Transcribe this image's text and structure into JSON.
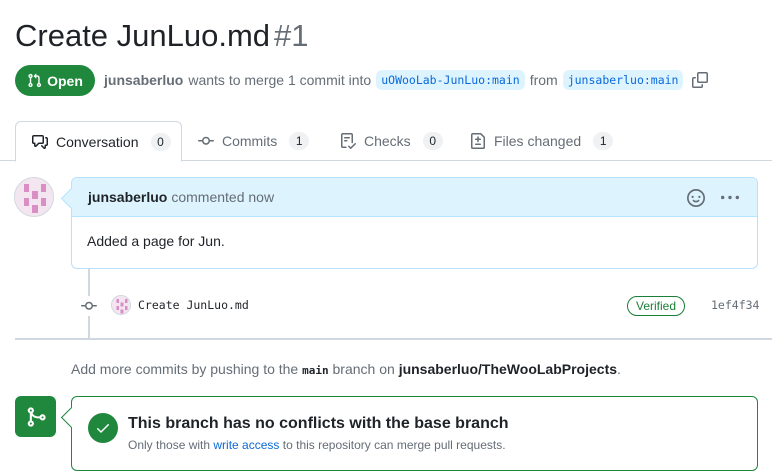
{
  "pr": {
    "title": "Create JunLuo.md",
    "number": "#1",
    "state": "Open",
    "author": "junsaberluo",
    "merge_text": "wants to merge 1 commit into",
    "base_branch": "uOWooLab-JunLuo:main",
    "from_text": "from",
    "head_branch": "junsaberluo:main"
  },
  "tabs": [
    {
      "label": "Conversation",
      "count": "0",
      "icon": "comment-discussion-icon"
    },
    {
      "label": "Commits",
      "count": "1",
      "icon": "git-commit-icon"
    },
    {
      "label": "Checks",
      "count": "0",
      "icon": "checklist-icon"
    },
    {
      "label": "Files changed",
      "count": "1",
      "icon": "file-diff-icon"
    }
  ],
  "comment": {
    "author": "junsaberluo",
    "action": "commented now",
    "body": "Added a page for Jun."
  },
  "commit": {
    "message": "Create JunLuo.md",
    "badge": "Verified",
    "sha": "1ef4f34"
  },
  "push_note": {
    "prefix": "Add more commits by pushing to the",
    "branch": "main",
    "middle": "branch on",
    "repo": "junsaberluo/TheWooLabProjects",
    "suffix": "."
  },
  "merge": {
    "title": "This branch has no conflicts with the base branch",
    "sub_prefix": "Only those with",
    "sub_link": "write access",
    "sub_suffix": "to this repository can merge pull requests."
  },
  "colors": {
    "open_green": "#1f883d",
    "link_blue": "#0969da",
    "header_blue": "#ddf4ff"
  }
}
